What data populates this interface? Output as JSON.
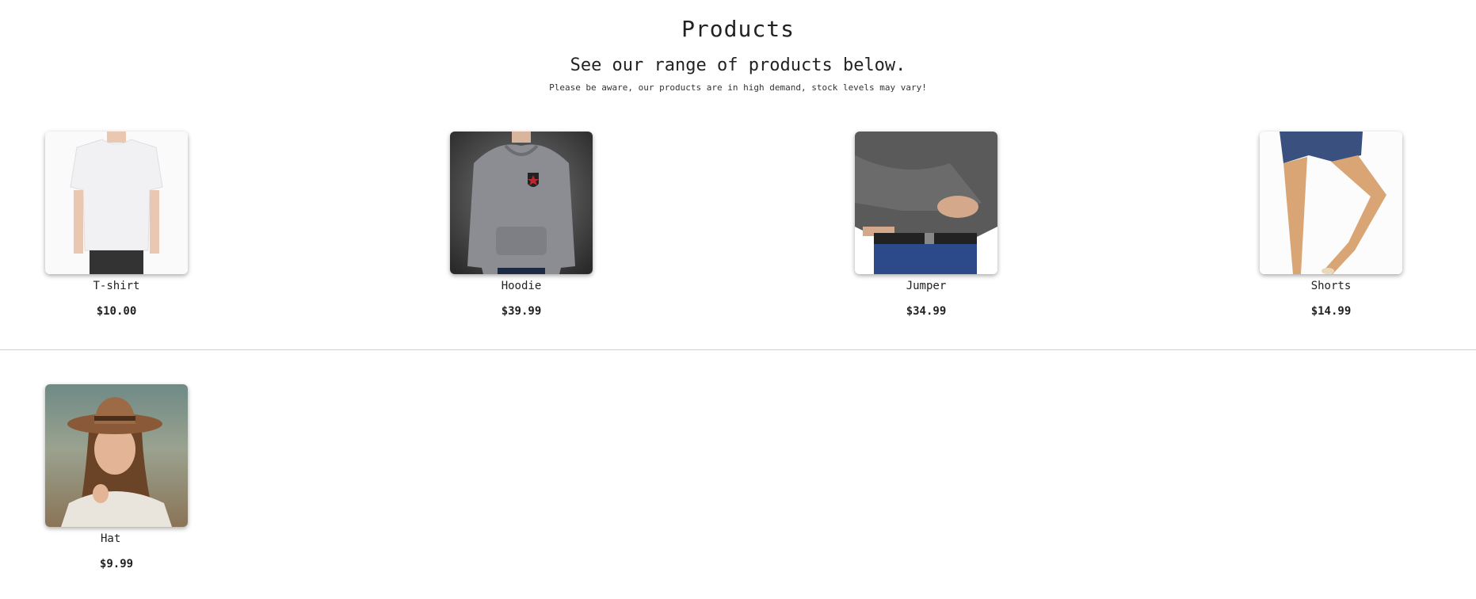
{
  "header": {
    "title": "Products",
    "subtitle": "See our range of products below.",
    "notice": "Please be aware, our products are in high demand, stock levels may vary!"
  },
  "products": [
    {
      "name": "T-shirt",
      "price": "$10.00",
      "image": "t-shirt-image"
    },
    {
      "name": "Hoodie",
      "price": "$39.99",
      "image": "hoodie-image"
    },
    {
      "name": "Jumper",
      "price": "$34.99",
      "image": "jumper-image"
    },
    {
      "name": "Shorts",
      "price": "$14.99",
      "image": "shorts-image"
    },
    {
      "name": "Hat",
      "price": "$9.99",
      "image": "hat-image"
    }
  ]
}
